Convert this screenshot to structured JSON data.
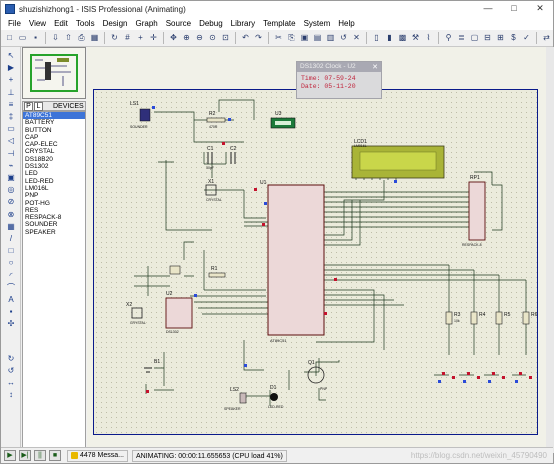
{
  "window": {
    "title": "shuzishizhong1 - ISIS Professional (Animating)",
    "minimize_glyph": "—",
    "maximize_glyph": "□",
    "close_glyph": "✕"
  },
  "menu": [
    "File",
    "View",
    "Edit",
    "Tools",
    "Design",
    "Graph",
    "Source",
    "Debug",
    "Library",
    "Template",
    "System",
    "Help"
  ],
  "toolbar_icons": [
    "new-icon",
    "open-icon",
    "save-icon",
    "import-icon",
    "export-icon",
    "print-icon",
    "print-area-icon",
    "refresh-icon",
    "grid-icon",
    "origin-icon",
    "crosshair-icon",
    "pan-icon",
    "zoom-in-icon",
    "zoom-out-icon",
    "zoom-all-icon",
    "zoom-area-icon",
    "undo-icon",
    "redo-icon",
    "cut-icon",
    "copy-icon",
    "paste-icon",
    "block-copy-icon",
    "block-move-icon",
    "block-rotate-icon",
    "block-delete-icon",
    "pick-device-icon",
    "make-device-icon",
    "package-tool-icon",
    "decompose-icon",
    "wire-autorouter-icon",
    "search-icon",
    "property-tool-icon",
    "new-sheet-icon",
    "remove-sheet-icon",
    "goto-sheet-icon",
    "bom-icon",
    "erc-icon",
    "netlist-icon"
  ],
  "left_tool_icons": [
    "selection-mode-icon",
    "component-mode-icon",
    "junction-icon",
    "wire-label-icon",
    "text-script-icon",
    "bus-icon",
    "subcircuit-icon",
    "terminals-icon",
    "device-pins-icon",
    "graph-icon",
    "tape-icon",
    "generator-icon",
    "voltage-probe-icon",
    "current-probe-icon",
    "virtual-instrument-icon",
    "line-icon",
    "box-icon",
    "circle-icon",
    "arc-icon",
    "path-icon",
    "text-icon",
    "symbol-icon",
    "marker-icon",
    "rotate-cw-icon",
    "rotate-ccw-icon",
    "mirror-x-icon",
    "mirror-y-icon"
  ],
  "devices": {
    "pick_button": "P",
    "library_button": "L",
    "header": "DEVICES",
    "items": [
      "AT89C51",
      "BATTERY",
      "BUTTON",
      "CAP",
      "CAP-ELEC",
      "CRYSTAL",
      "DS18B20",
      "DS1302",
      "LED",
      "LED-RED",
      "LM016L",
      "PNP",
      "POT-HG",
      "RES",
      "RESPACK-8",
      "SOUNDER",
      "SPEAKER"
    ],
    "selected_index": 0
  },
  "popup": {
    "title": "DS1302 Clock - U2",
    "close_glyph": "✕",
    "time_line": "Time: 07-59-24",
    "date_line": "Date: 05-11-20"
  },
  "status": {
    "play_glyph": "▶",
    "step_glyph": "▶|",
    "pause_glyph": "||",
    "stop_glyph": "■",
    "messages": "4478 Messa...",
    "sim": "ANIMATING: 00:00:11.655653 (CPU load 41%)",
    "watermark": "https://blog.csdn.net/weixin_45790490"
  },
  "schematic_labels": {
    "ls1": "LS1",
    "sounder": "SOUNDER",
    "r2": "R2",
    "r2v": "470R",
    "u3": "U3",
    "lcd1": "LCD1",
    "lcd_model": "LM016L",
    "c1": "C1",
    "c2": "C2",
    "cval": "30pF",
    "x1": "X1",
    "crystal": "CRYSTAL",
    "u1": "U1",
    "mcu": "AT89C51",
    "rp1": "RP1",
    "respack": "RESPACK-8",
    "r1": "R1",
    "u2": "U2",
    "ds1302": "DS1302",
    "x2": "X2",
    "r3": "R3",
    "r4": "R4",
    "r5": "R5",
    "r6": "R6",
    "rv": "10k",
    "b1": "B1",
    "q1": "Q1",
    "pnp": "PNP",
    "ls2": "LS2",
    "speaker": "SPEAKER",
    "d1": "D1",
    "ledred": "LED-RED"
  }
}
